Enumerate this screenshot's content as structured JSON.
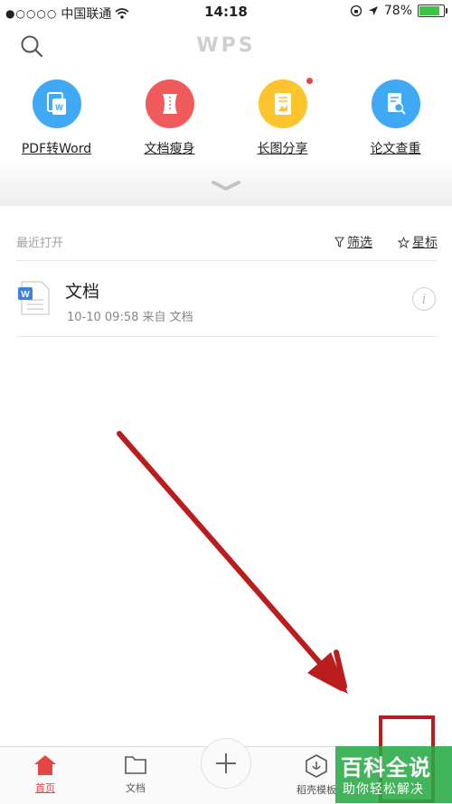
{
  "status": {
    "carrier": "中国联通",
    "time": "14:18",
    "battery": "78%",
    "battery_level": 0.78
  },
  "header": {
    "logo": "WPS",
    "tools": [
      {
        "label": "PDF转Word",
        "color": "#3fa9f5",
        "icon": "pdf-to-word-icon"
      },
      {
        "label": "文档瘦身",
        "color": "#f05a5a",
        "icon": "slim-doc-icon"
      },
      {
        "label": "长图分享",
        "color": "#fdc42e",
        "icon": "long-image-icon",
        "badge": true
      },
      {
        "label": "论文查重",
        "color": "#3fa9f5",
        "icon": "paper-check-icon"
      }
    ]
  },
  "recent": {
    "title": "最近打开",
    "filter": "筛选",
    "star": "星标",
    "files": [
      {
        "name": "文档",
        "meta": "10-10 09:58  来自 文档"
      }
    ]
  },
  "tabs": [
    {
      "label": "首页",
      "active": true
    },
    {
      "label": "文档",
      "active": false
    },
    {
      "label": "稻壳模板",
      "active": false
    }
  ],
  "watermark": {
    "title": "百科全说",
    "subtitle": "助你轻松解决"
  },
  "colors": {
    "accent": "#e64545",
    "annotation": "#b91d1d"
  }
}
